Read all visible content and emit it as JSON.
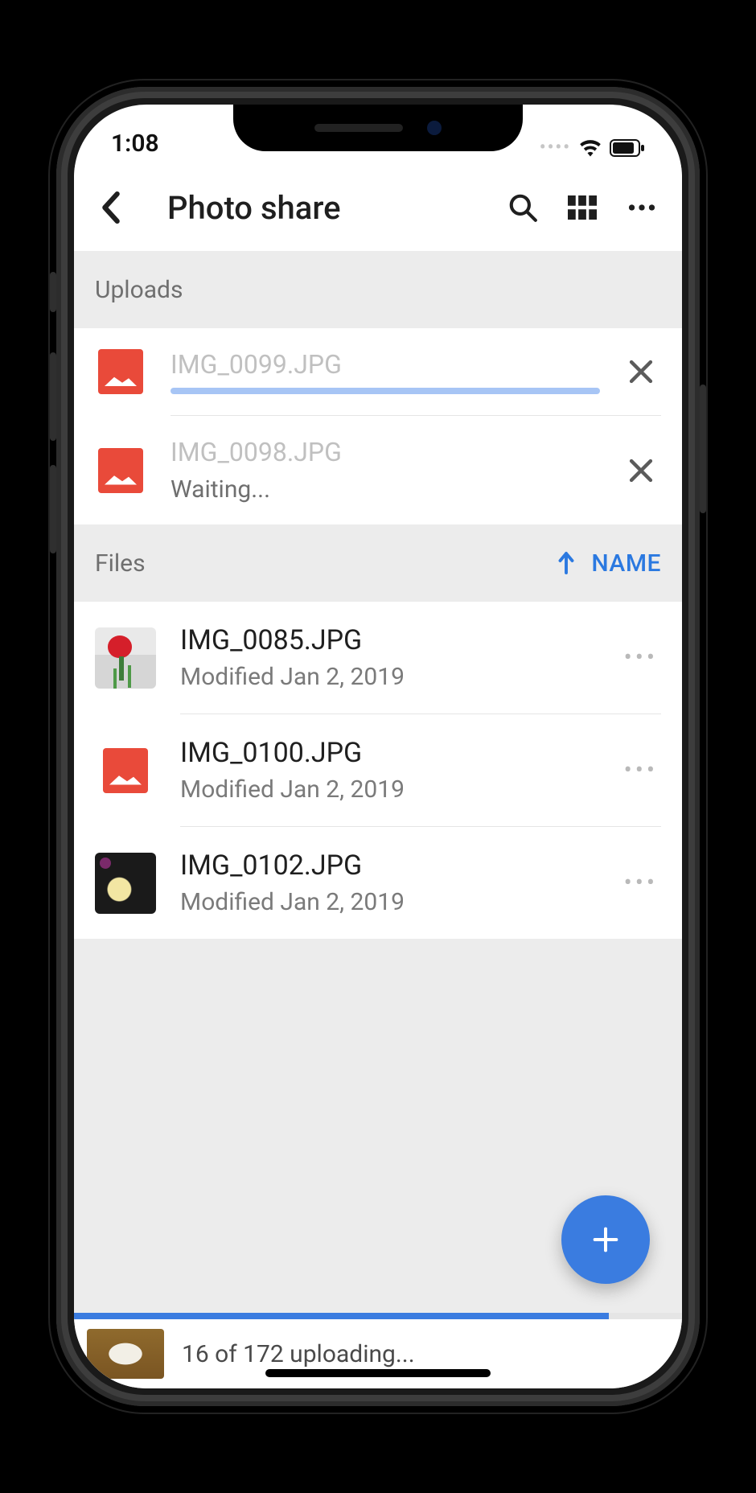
{
  "status": {
    "time": "1:08"
  },
  "header": {
    "title": "Photo share"
  },
  "sections": {
    "uploads_label": "Uploads",
    "files_label": "Files",
    "sort_label": "NAME"
  },
  "uploads": [
    {
      "name": "IMG_0099.JPG",
      "progress_pct": 100
    },
    {
      "name": "IMG_0098.JPG",
      "status": "Waiting..."
    }
  ],
  "files": [
    {
      "name": "IMG_0085.JPG",
      "modified": "Modified Jan 2, 2019"
    },
    {
      "name": "IMG_0100.JPG",
      "modified": "Modified Jan 2, 2019"
    },
    {
      "name": "IMG_0102.JPG",
      "modified": "Modified Jan 2, 2019"
    }
  ],
  "bottom": {
    "status": "16 of 172 uploading...",
    "overall_progress_pct": 88
  },
  "colors": {
    "accent": "#3a7ce0",
    "upload_bar": "#a7c5f5",
    "danger_icon": "#e94a3a"
  }
}
